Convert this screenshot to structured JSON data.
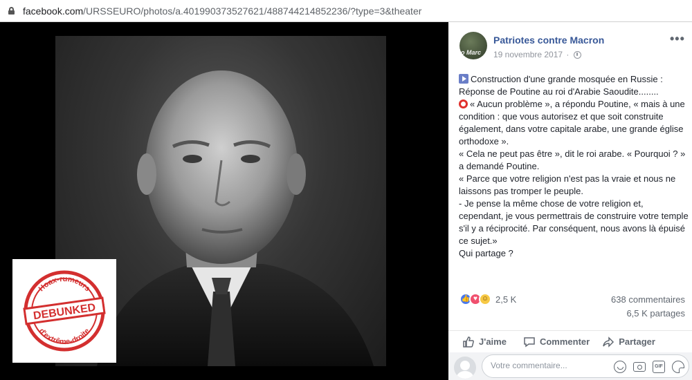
{
  "browser": {
    "url_domain": "facebook.com",
    "url_path": "/URSSEURO/photos/a.401990373527621/488744214852236/?type=3&theater"
  },
  "stamp": {
    "top_text": "Hoax-rumeurs",
    "center_text": "DEBUNKED",
    "bottom_text": "d'extrême-droite",
    "color": "#d32f2f"
  },
  "post": {
    "page_name": "Patriotes contre Macron",
    "avatar_text": "o Marc",
    "date": "19 novembre 2017",
    "privacy_icon": "globe-icon",
    "more_label": "•••",
    "paragraphs": [
      "Construction d'une grande mosquée en Russie : Réponse de Poutine au roi d'Arabie Saoudite........",
      "« Aucun problème », a répondu Poutine, « mais à une condition : que vous autorisez et que soit construite également, dans votre capitale arabe, une grande église orthodoxe ».",
      "« Cela ne peut pas être », dit le roi arabe. « Pourquoi ? » a demandé Poutine.",
      "« Parce que votre religion n'est pas la vraie et nous ne laissons pas tromper le peuple.",
      "- Je pense la même chose de votre religion et, cependant, je vous permettrais de construire votre temple s'il y a réciprocité. Par conséquent, nous avons là épuisé ce sujet.»",
      "Qui partage ?"
    ]
  },
  "stats": {
    "reactions": "2,5 K",
    "comments": "638 commentaires",
    "shares": "6,5 K partages"
  },
  "actions": {
    "like": "J'aime",
    "comment": "Commenter",
    "share": "Partager"
  },
  "comment_box": {
    "placeholder": "Votre commentaire..."
  },
  "colors": {
    "link": "#385898",
    "like_blue": "#4a7aed",
    "love_red": "#f0506e",
    "haha_yellow": "#f7c945"
  }
}
